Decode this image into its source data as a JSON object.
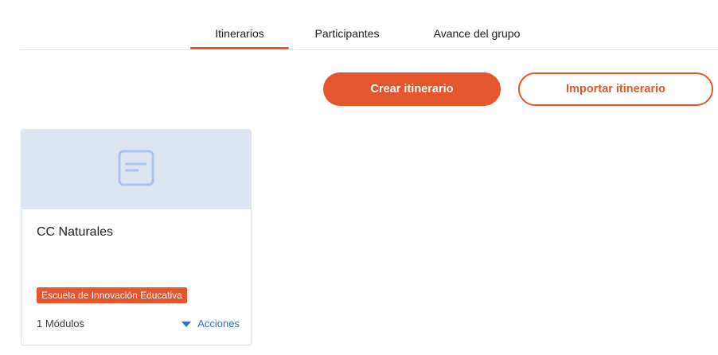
{
  "tabs": [
    {
      "label": "Itinerarios",
      "active": true
    },
    {
      "label": "Participantes",
      "active": false
    },
    {
      "label": "Avance del grupo",
      "active": false
    }
  ],
  "actions": {
    "create_label": "Crear itinerario",
    "import_label": "Importar itinerario"
  },
  "card": {
    "title": "CC Naturales",
    "badge": "Escuela de Innovación Educativa",
    "modules": "1 Módulos",
    "actions_label": "Acciones",
    "cover_icon": "document-icon"
  },
  "colors": {
    "accent": "#e4572e",
    "link": "#2f6fd6",
    "cover_bg": "#dce5f1"
  }
}
